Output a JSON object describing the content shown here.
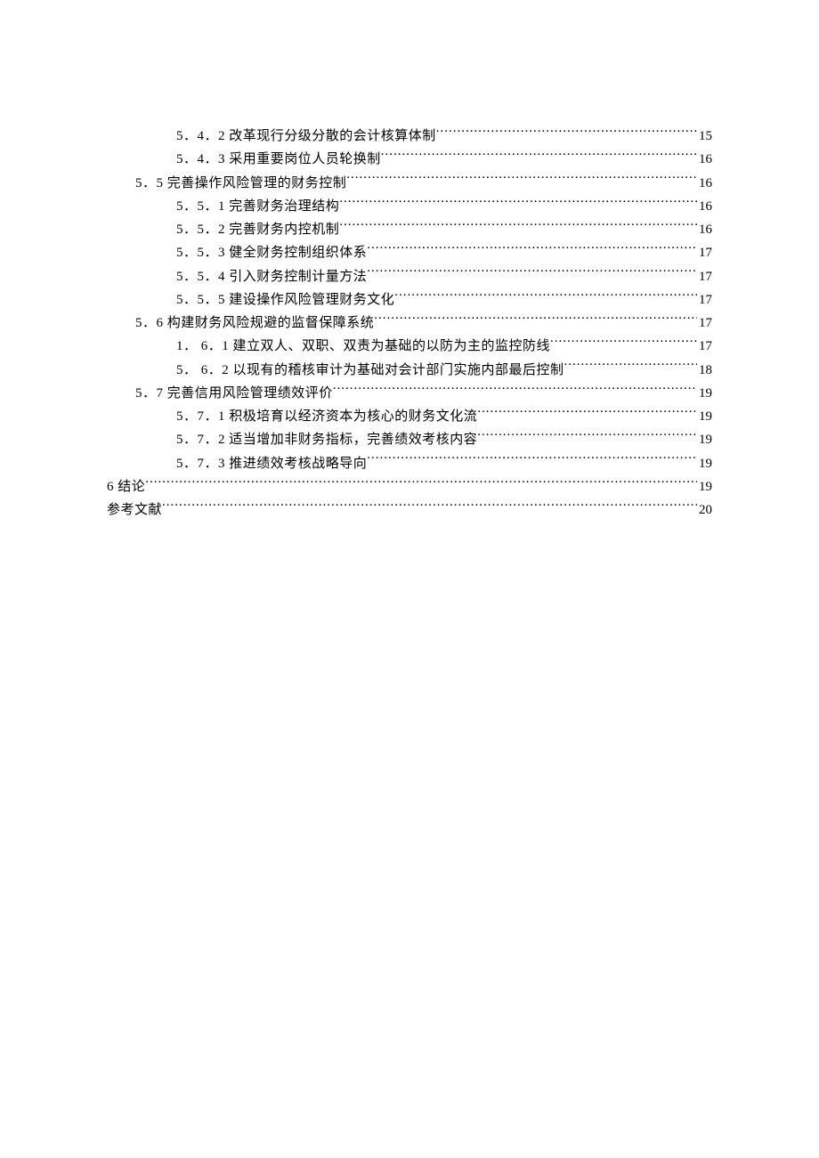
{
  "toc": [
    {
      "level": 2,
      "label": "5．4．2 改革现行分级分散的会计核算体制",
      "page": "15"
    },
    {
      "level": 2,
      "label": "5．4．3 采用重要岗位人员轮换制",
      "page": "16"
    },
    {
      "level": 1,
      "label": "5．5 完善操作风险管理的财务控制",
      "page": "16"
    },
    {
      "level": 2,
      "label": "5．5．1 完善财务治理结构",
      "page": "16"
    },
    {
      "level": 2,
      "label": "5．5．2 完善财务内控机制",
      "page": "16"
    },
    {
      "level": 2,
      "label": "5．5．3 健全财务控制组织体系",
      "page": "17"
    },
    {
      "level": 2,
      "label": "5．5．4 引入财务控制计量方法",
      "page": "17"
    },
    {
      "level": 2,
      "label": "5．5．5 建设操作风险管理财务文化",
      "page": "17"
    },
    {
      "level": 1,
      "label": "5．6 构建财务风险规避的监督保障系统",
      "page": "17"
    },
    {
      "level": 2,
      "label": "1． 6．1 建立双人、双职、双责为基础的以防为主的监控防线",
      "page": "17"
    },
    {
      "level": 2,
      "label": "5． 6．2 以现有的稽核审计为基础对会计部门实施内部最后控制",
      "page": "18"
    },
    {
      "level": 1,
      "label": "5．7 完善信用风险管理绩效评价",
      "page": "19"
    },
    {
      "level": 2,
      "label": "5．7．1 积极培育以经济资本为核心的财务文化流",
      "page": "19"
    },
    {
      "level": 2,
      "label": "5．7．2 适当增加非财务指标，完善绩效考核内容",
      "page": "19"
    },
    {
      "level": 2,
      "label": "5．7．3 推进绩效考核战略导向",
      "page": "19"
    },
    {
      "level": 0,
      "label": "6 结论",
      "page": "19"
    },
    {
      "level": 0,
      "label": "参考文献",
      "page": "20"
    }
  ]
}
